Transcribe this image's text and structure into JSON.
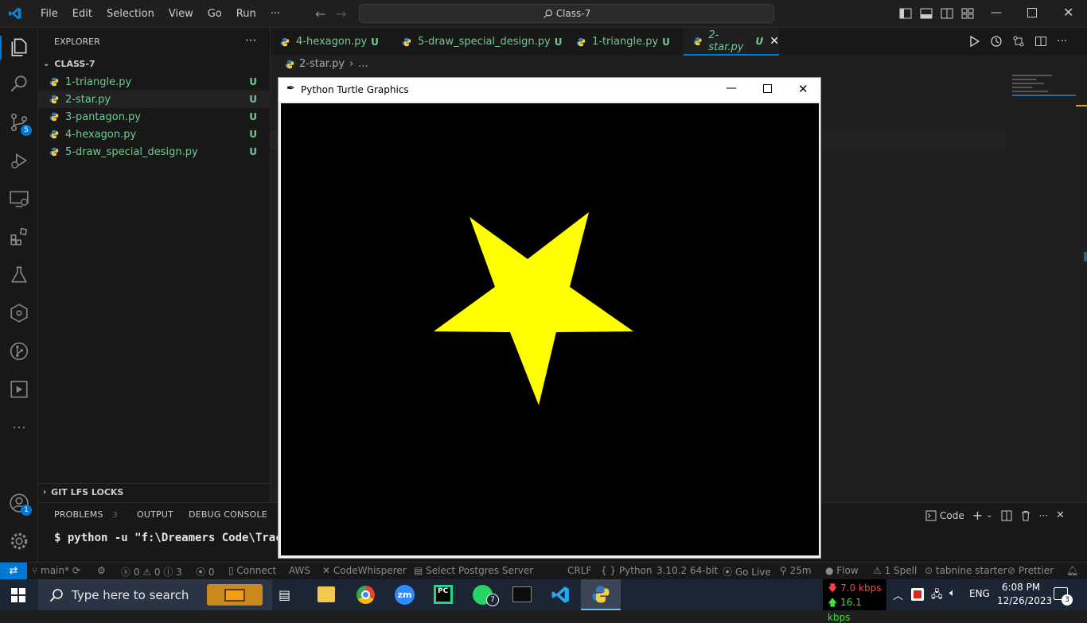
{
  "titlebar": {
    "menu": [
      "File",
      "Edit",
      "Selection",
      "View",
      "Go",
      "Run",
      "···"
    ],
    "search": "Class-7"
  },
  "activity": {
    "scm_badge": "5",
    "account_badge": "1"
  },
  "sidebar": {
    "title": "EXPLORER",
    "more": "···",
    "folder": "CLASS-7",
    "files": [
      {
        "name": "1-triangle.py",
        "status": "U"
      },
      {
        "name": "2-star.py",
        "status": "U"
      },
      {
        "name": "3-pantagon.py",
        "status": "U"
      },
      {
        "name": "4-hexagon.py",
        "status": "U"
      },
      {
        "name": "5-draw_special_design.py",
        "status": "U"
      }
    ],
    "git_lfs": "GIT LFS LOCKS"
  },
  "tabs": [
    {
      "name": "4-hexagon.py",
      "status": "U"
    },
    {
      "name": "5-draw_special_design.py",
      "status": "U"
    },
    {
      "name": "1-triangle.py",
      "status": "U"
    },
    {
      "name": "2-star.py",
      "status": "U"
    }
  ],
  "breadcrumb": {
    "file": "2-star.py",
    "rest": "..."
  },
  "panel": {
    "tabs": [
      "PROBLEMS",
      "OUTPUT",
      "DEBUG CONSOLE"
    ],
    "problems_count": "3",
    "terminal_line": "$ python -u \"f:\\Dreamers Code\\Track",
    "terminal_name": "Code"
  },
  "turtle": {
    "title": "Python Turtle Graphics",
    "fill": "#ffff00",
    "bg": "#000000"
  },
  "status": {
    "branch": "main*",
    "errors": "0",
    "warnings": "0",
    "info": "3",
    "ports": "0",
    "connect": "Connect",
    "aws": "AWS",
    "codewhisperer": "CodeWhisperer",
    "postgres": "Select Postgres Server",
    "eol": "CRLF",
    "language": "Python",
    "version": "3.10.2 64-bit",
    "golive": "Go Live",
    "time_tracker": "25m",
    "flow": "Flow",
    "spell": "1 Spell",
    "tabnine": "tabnine starter",
    "prettier": "Prettier"
  },
  "taskbar": {
    "search_placeholder": "Type here to search",
    "down_speed": "7.0 kbps",
    "up_speed": "16.1 kbps",
    "lang": "ENG",
    "time": "6:08 PM",
    "date": "12/26/2023",
    "notif": "3",
    "whatsapp_badge": "7"
  }
}
